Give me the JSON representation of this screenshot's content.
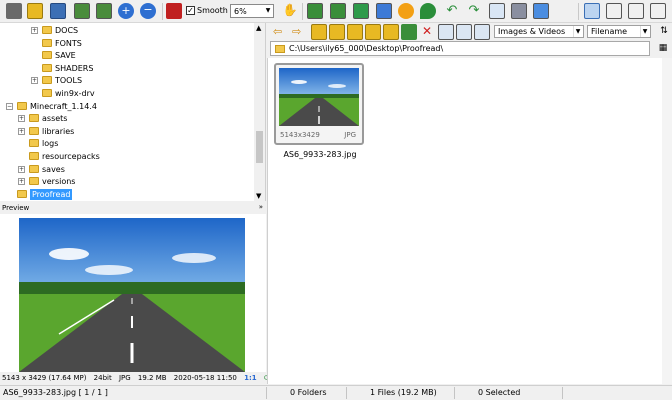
{
  "toolbar": {
    "smooth_checked": "✓",
    "smooth_label": "Smooth",
    "zoom_value": "6%",
    "icons": [
      "camera-icon",
      "open-folder-icon",
      "save-icon",
      "scan-icon",
      "fullscreen-icon",
      "zoom-in-icon",
      "zoom-out-icon",
      "hand-icon",
      "fit-icon",
      "slideshow-icon",
      "resize-icon",
      "crop-icon",
      "rotate-icon",
      "brightness-icon",
      "map-pin-icon",
      "rotate-left-icon",
      "rotate-right-icon",
      "edit-icon",
      "print-icon",
      "settings-icon",
      "layout-1-icon",
      "layout-2-icon",
      "layout-3-icon",
      "layout-4-icon"
    ]
  },
  "tree": {
    "items": [
      {
        "label": "DOCS",
        "level": 2,
        "exp": "+"
      },
      {
        "label": "FONTS",
        "level": 2,
        "exp": ""
      },
      {
        "label": "SAVE",
        "level": 2,
        "exp": ""
      },
      {
        "label": "SHADERS",
        "level": 2,
        "exp": ""
      },
      {
        "label": "TOOLS",
        "level": 2,
        "exp": "+"
      },
      {
        "label": "win9x-drv",
        "level": 2,
        "exp": ""
      },
      {
        "label": "Minecraft_1.14.4",
        "level": 0,
        "exp": "-"
      },
      {
        "label": "assets",
        "level": 1,
        "exp": "+"
      },
      {
        "label": "libraries",
        "level": 1,
        "exp": "+"
      },
      {
        "label": "logs",
        "level": 1,
        "exp": ""
      },
      {
        "label": "resourcepacks",
        "level": 1,
        "exp": ""
      },
      {
        "label": "saves",
        "level": 1,
        "exp": "+"
      },
      {
        "label": "versions",
        "level": 1,
        "exp": "+"
      },
      {
        "label": "Proofread",
        "level": 0,
        "exp": "",
        "selected": true
      }
    ]
  },
  "preview": {
    "title": "Preview",
    "collapse": "»",
    "info": {
      "dims": "5143 x 3429 (17.64 MP)",
      "bits": "24bit",
      "type": "JPG",
      "size": "19.2 MB",
      "date": "2020-05-18 11:50",
      "ratio": "1:1"
    }
  },
  "nav": {
    "filter": "Images & Videos",
    "sort": "Filename"
  },
  "path": {
    "value": "C:\\Users\\ily65_000\\Desktop\\Proofread\\"
  },
  "browser": {
    "file": {
      "dims": "5143x3429",
      "type": "JPG",
      "name": "AS6_9933-283.jpg"
    }
  },
  "status": {
    "file": "AS6_9933-283.jpg [ 1 / 1 ]",
    "folders": "0 Folders",
    "files": "1 Files (19.2 MB)",
    "selected": "0 Selected"
  },
  "colors": {
    "selection": "#3399ff",
    "folder": "#f2c84b",
    "sky": "#2f78d6",
    "grass": "#5aa62e",
    "road": "#4a4a4a"
  }
}
